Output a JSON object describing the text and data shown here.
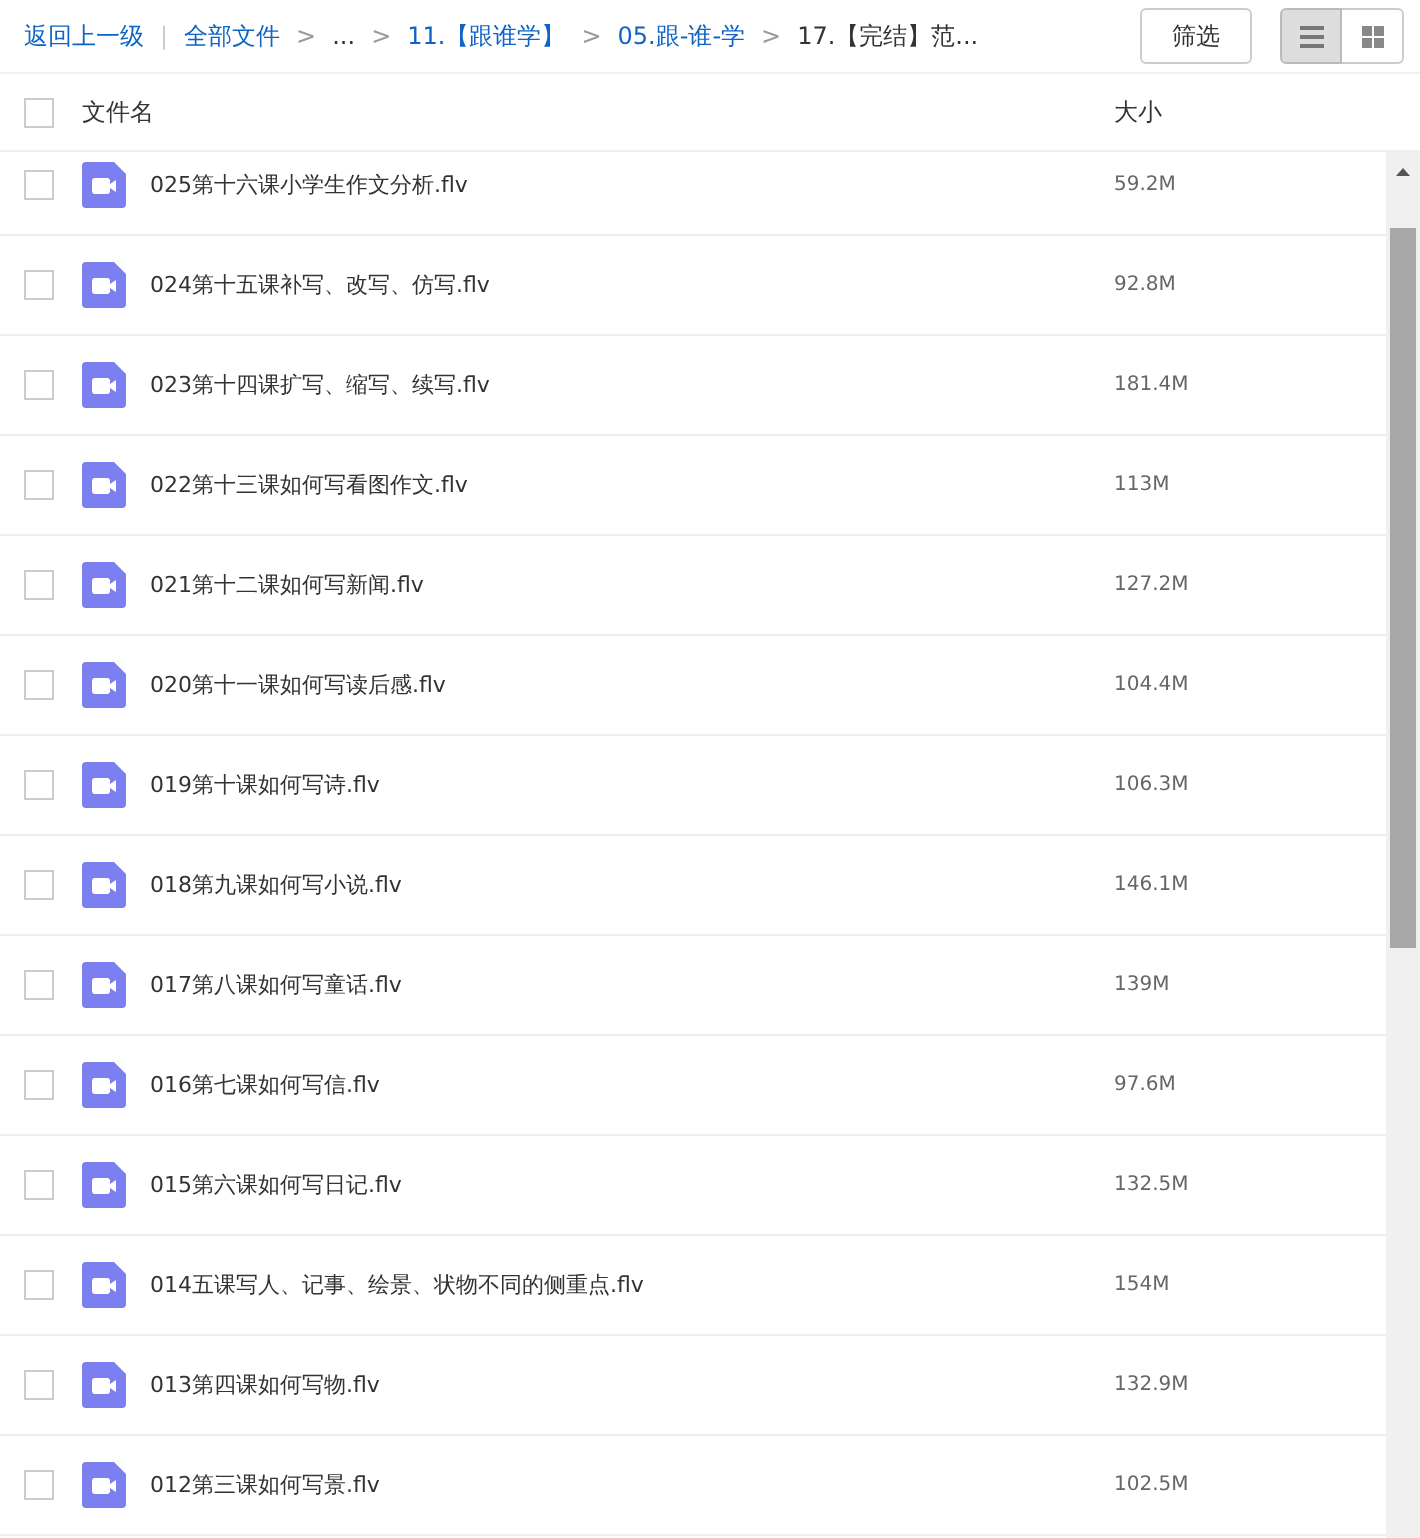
{
  "breadcrumb": {
    "back": "返回上一级",
    "divider": "|",
    "items": [
      {
        "label": "全部文件",
        "link": true
      },
      {
        "label": "...",
        "link": false
      },
      {
        "label": "11.【跟谁学】",
        "link": true
      },
      {
        "label": "05.跟-谁-学",
        "link": true
      },
      {
        "label": "17.【完结】范...",
        "link": false
      }
    ],
    "separator": ">"
  },
  "toolbar": {
    "filter_button": "筛选",
    "views": [
      {
        "kind": "list",
        "selected": true
      },
      {
        "kind": "grid",
        "selected": false
      }
    ]
  },
  "header": {
    "checked": false,
    "name": "文件名",
    "size": "大小"
  },
  "rows": [
    {
      "name": "025第十六课小学生作文分析.flv",
      "size": "59.2M",
      "checked": false
    },
    {
      "name": "024第十五课补写、改写、仿写.flv",
      "size": "92.8M",
      "checked": false
    },
    {
      "name": "023第十四课扩写、缩写、续写.flv",
      "size": "181.4M",
      "checked": false
    },
    {
      "name": "022第十三课如何写看图作文.flv",
      "size": "113M",
      "checked": false
    },
    {
      "name": "021第十二课如何写新闻.flv",
      "size": "127.2M",
      "checked": false
    },
    {
      "name": "020第十一课如何写读后感.flv",
      "size": "104.4M",
      "checked": false
    },
    {
      "name": "019第十课如何写诗.flv",
      "size": "106.3M",
      "checked": false
    },
    {
      "name": "018第九课如何写小说.flv",
      "size": "146.1M",
      "checked": false
    },
    {
      "name": "017第八课如何写童话.flv",
      "size": "139M",
      "checked": false
    },
    {
      "name": "016第七课如何写信.flv",
      "size": "97.6M",
      "checked": false
    },
    {
      "name": "015第六课如何写日记.flv",
      "size": "132.5M",
      "checked": false
    },
    {
      "name": "014五课写人、记事、绘景、状物不同的侧重点.flv",
      "size": "154M",
      "checked": false
    },
    {
      "name": "013第四课如何写物.flv",
      "size": "132.9M",
      "checked": false
    },
    {
      "name": "012第三课如何写景.flv",
      "size": "102.5M",
      "checked": false
    }
  ]
}
